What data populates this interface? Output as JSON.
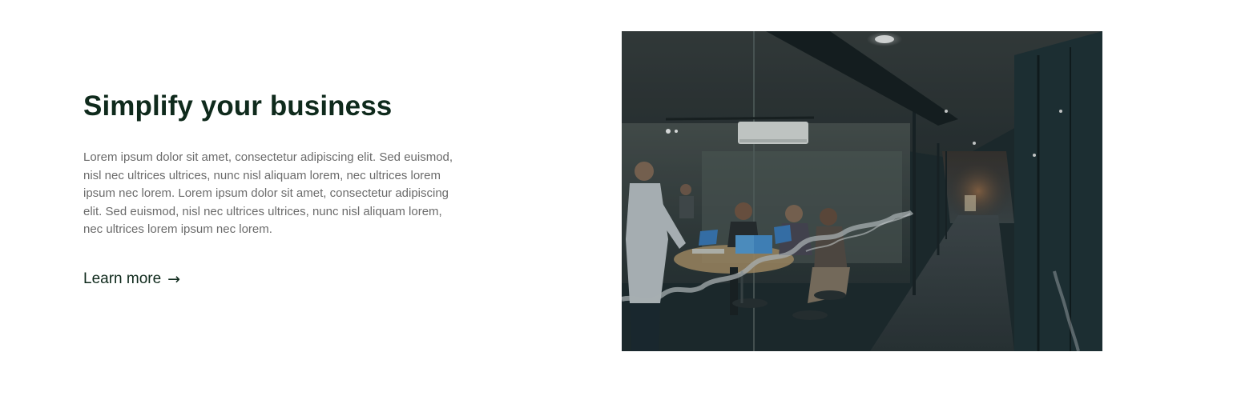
{
  "feature": {
    "headline": "Simplify your business",
    "body": "Lorem ipsum dolor sit amet, consectetur adipiscing elit. Sed euismod, nisl nec ultrices ultrices, nunc nisl aliquam lorem, nec ultrices lorem ipsum nec lorem. Lorem ipsum dolor sit amet, consectetur adipiscing elit. Sed euismod, nisl nec ultrices ultrices, nunc nisl aliquam lorem, nec ultrices lorem ipsum nec lorem.",
    "link_label": "Learn more",
    "link_arrow": "→"
  },
  "colors": {
    "headline": "#0f2a1c",
    "body": "#6b6b6b",
    "background": "#ffffff"
  }
}
